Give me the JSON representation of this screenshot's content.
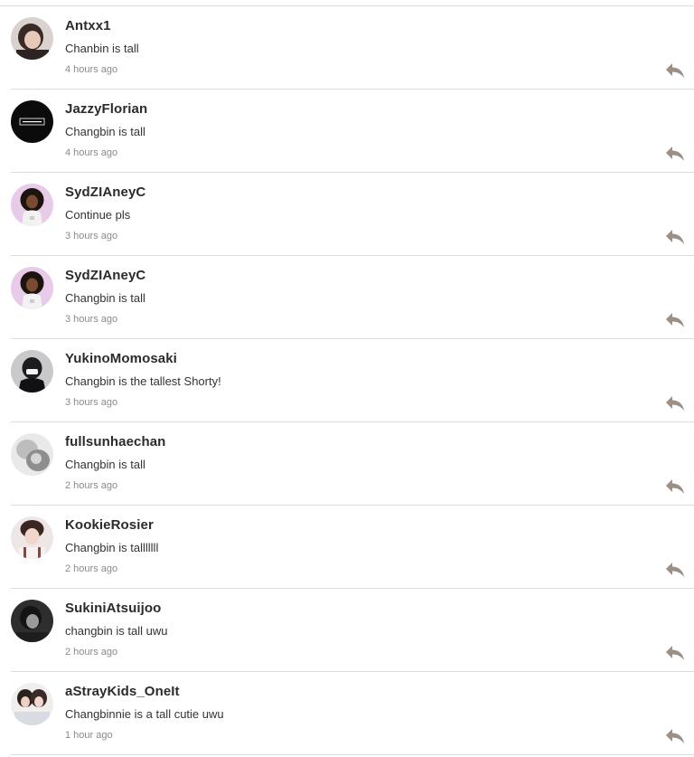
{
  "colors": {
    "divider": "#dcdcdc",
    "username": "#2b2b2b",
    "timestamp": "#8a8a8a",
    "reply_icon": "#9e8f86"
  },
  "comments": [
    {
      "username": "Antxx1",
      "text": "Chanbin is tall",
      "time": "4 hours ago",
      "avatar": "avatar-photo-icon",
      "reply_icon": "reply-arrow-icon"
    },
    {
      "username": "JazzyFlorian",
      "text": "Changbin is tall",
      "time": "4 hours ago",
      "avatar": "avatar-black-logo-icon",
      "reply_icon": "reply-arrow-icon"
    },
    {
      "username": "SydZIAneyC",
      "text": "Continue pls",
      "time": "3 hours ago",
      "avatar": "avatar-illustration-icon",
      "reply_icon": "reply-arrow-icon"
    },
    {
      "username": "SydZIAneyC",
      "text": "Changbin is tall",
      "time": "3 hours ago",
      "avatar": "avatar-illustration-icon",
      "reply_icon": "reply-arrow-icon"
    },
    {
      "username": "YukinoMomosaki",
      "text": "Changbin is the tallest Shorty!",
      "time": "3 hours ago",
      "avatar": "avatar-masked-figure-icon",
      "reply_icon": "reply-arrow-icon"
    },
    {
      "username": "fullsunhaechan",
      "text": "Changbin is tall",
      "time": "2 hours ago",
      "avatar": "avatar-photo-icon",
      "reply_icon": "reply-arrow-icon"
    },
    {
      "username": "KookieRosier",
      "text": "Changbin is talllllll",
      "time": "2 hours ago",
      "avatar": "avatar-photo-icon",
      "reply_icon": "reply-arrow-icon"
    },
    {
      "username": "SukiniAtsuijoo",
      "text": "changbin is tall uwu",
      "time": "2 hours ago",
      "avatar": "avatar-photo-icon",
      "reply_icon": "reply-arrow-icon"
    },
    {
      "username": "aStrayKids_OneIt",
      "text": "Changbinnie is a tall cutie uwu",
      "time": "1 hour ago",
      "avatar": "avatar-photo-icon",
      "reply_icon": "reply-arrow-icon"
    }
  ]
}
